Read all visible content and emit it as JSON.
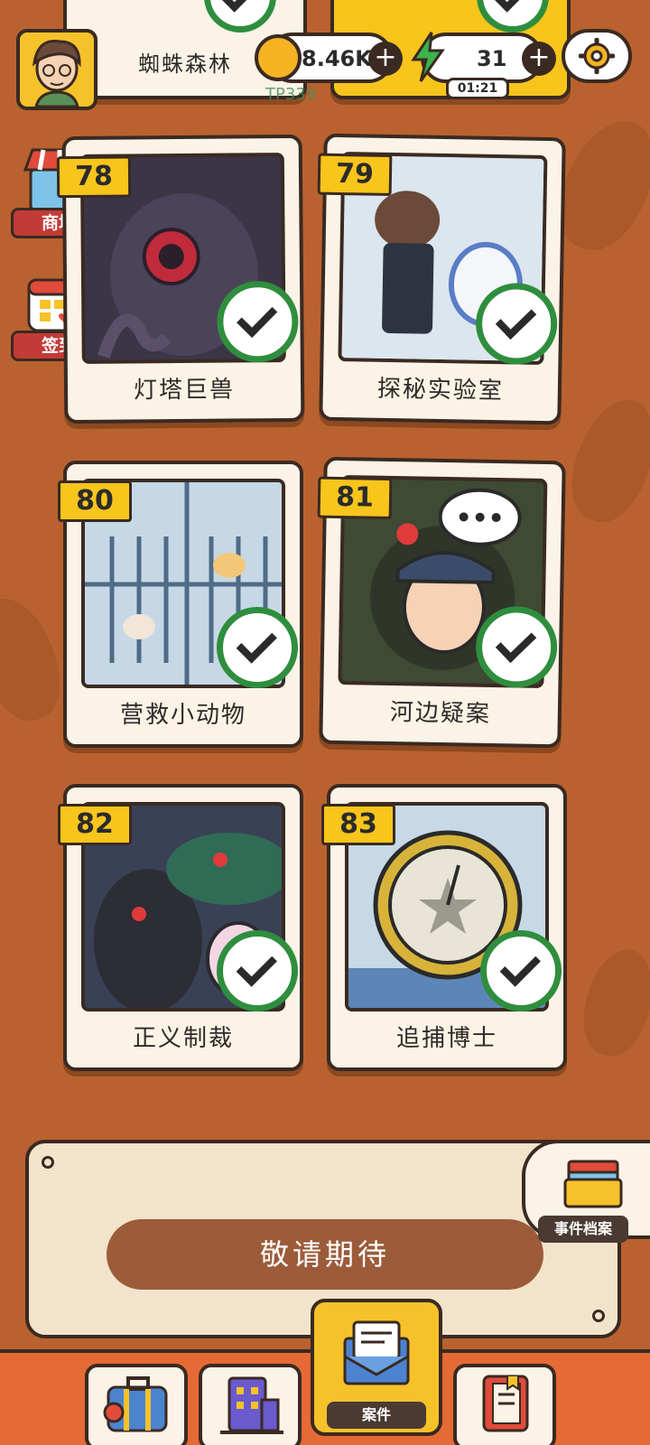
{
  "top_bar": {
    "coins": "8.46K",
    "energy": "31",
    "energy_timer": "01:21"
  },
  "side_buttons": {
    "shop_label": "商城",
    "signin_label": "签到"
  },
  "partial_top_cards": {
    "left_title": "蜘蛛森林",
    "faded_text": "TP339"
  },
  "cases": [
    {
      "number": "78",
      "title": "灯塔巨兽",
      "art_color": "#3b3646"
    },
    {
      "number": "79",
      "title": "探秘实验室",
      "art_color": "#d8e3ea"
    },
    {
      "number": "80",
      "title": "营救小动物",
      "art_color": "#bfd3e2"
    },
    {
      "number": "81",
      "title": "河边疑案",
      "art_color": "#3e4a33"
    },
    {
      "number": "82",
      "title": "正义制裁",
      "art_color": "#3a4156"
    },
    {
      "number": "83",
      "title": "追捕博士",
      "art_color": "#c7d8e6"
    }
  ],
  "bottom_panel": {
    "coming_soon": "敬请期待",
    "archive_label": "事件档案"
  },
  "tabs": [
    {
      "icon": "luggage-icon",
      "label": ""
    },
    {
      "icon": "building-icon",
      "label": ""
    },
    {
      "icon": "envelope-icon",
      "label": "案件"
    },
    {
      "icon": "notebook-icon",
      "label": ""
    }
  ],
  "colors": {
    "background": "#b9622f",
    "accent_yellow": "#f8c51c",
    "check_green": "#2f8e3e",
    "tabbar": "#e56a36"
  }
}
